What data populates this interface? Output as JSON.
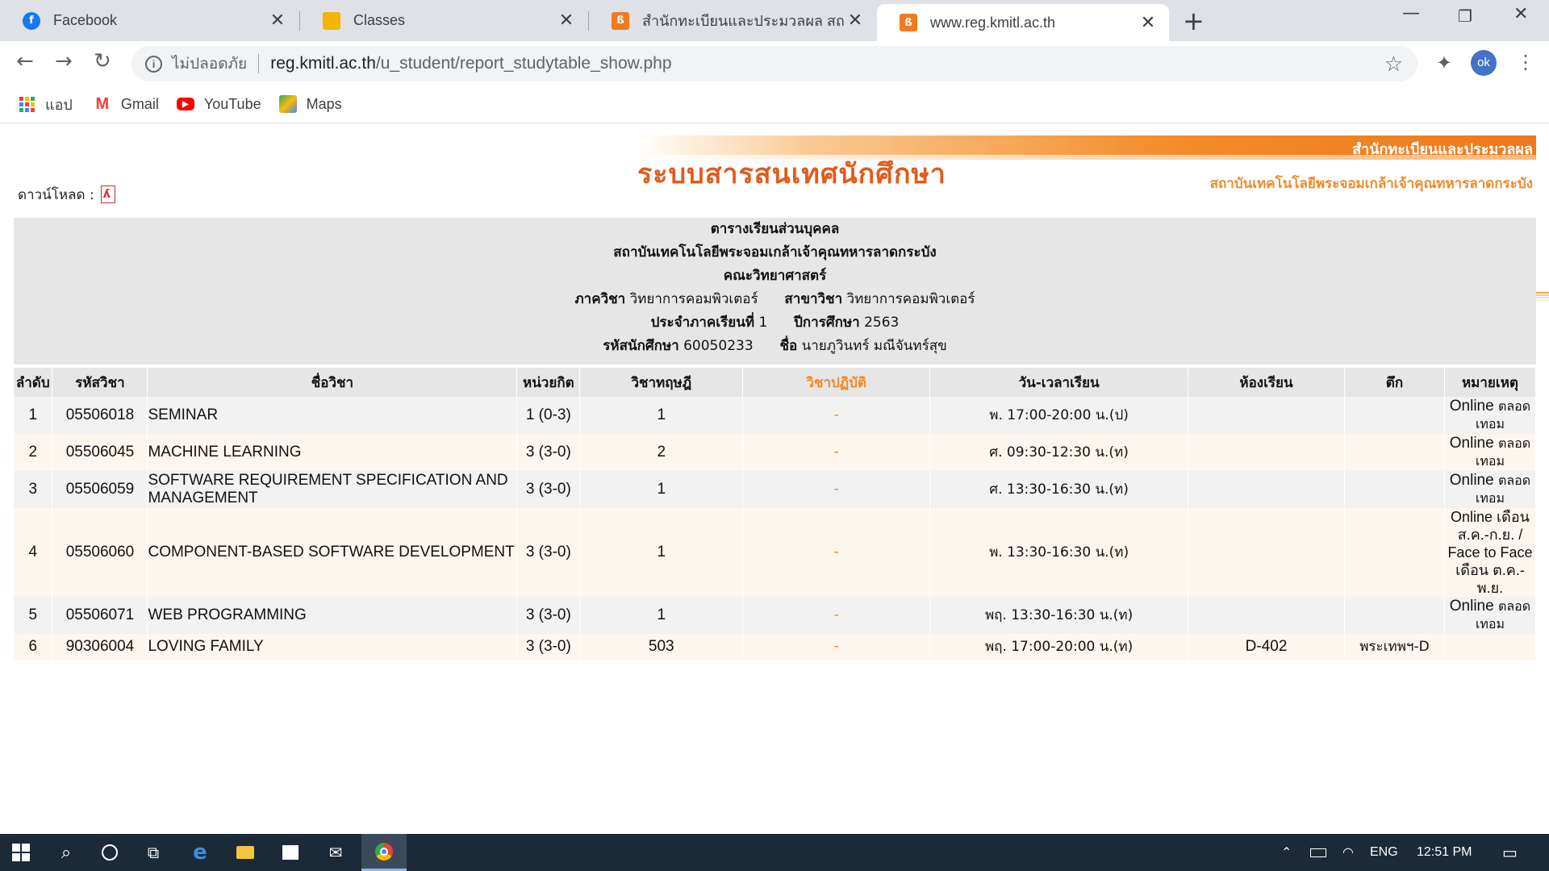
{
  "browser": {
    "tabs": [
      {
        "title": "Facebook",
        "favicon": "facebook-icon",
        "color": "#1877f2"
      },
      {
        "title": "Classes",
        "favicon": "classroom-icon",
        "color": "#f4b400"
      },
      {
        "title": "สำนักทะเบียนและประมวลผล สถาบันเท",
        "favicon": "reg-icon",
        "color": "#f07a20"
      },
      {
        "title": "www.reg.kmitl.ac.th",
        "favicon": "reg-icon",
        "color": "#f07a20"
      }
    ],
    "address": {
      "security_label": "ไม่ปลอดภัย",
      "host": "reg.kmitl.ac.th",
      "path": "/u_student/report_studytable_show.php"
    },
    "profile_initials": "ok",
    "bookmarks": [
      "แอป",
      "Gmail",
      "YouTube",
      "Maps"
    ]
  },
  "page": {
    "banner": {
      "system_title": "ระบบสารสนเทศนักศึกษา",
      "office": "สำนักทะเบียนและประมวลผล",
      "institute": "สถาบันเทคโนโลยีพระจอมเกล้าเจ้าคุณทหารลาดกระบัง"
    },
    "download_label": "ดาวน์โหลด :",
    "header": {
      "title": "ตารางเรียนส่วนบุคคล",
      "institute": "สถาบันเทคโนโลยีพระจอมเกล้าเจ้าคุณทหารลาดกระบัง",
      "faculty": "คณะวิทยาศาสตร์",
      "dept_label": "ภาควิชา",
      "dept_value": "วิทยาการคอมพิวเตอร์",
      "major_label": "สาขาวิชา",
      "major_value": "วิทยาการคอมพิวเตอร์",
      "semester_label": "ประจำภาคเรียนที่",
      "semester_value": "1",
      "year_label": "ปีการศึกษา",
      "year_value": "2563",
      "student_id_label": "รหัสนักศึกษา",
      "student_id_value": "60050233",
      "name_label": "ชื่อ",
      "name_value": "นายภูวินทร์ มณีจันทร์สุข"
    },
    "columns": [
      "ลำดับ",
      "รหัสวิชา",
      "ชื่อวิชา",
      "หน่วยกิต",
      "วิชาทฤษฎี",
      "วิชาปฏิบัติ",
      "วัน-เวลาเรียน",
      "ห้องเรียน",
      "ตึก",
      "หมายเหตุ"
    ],
    "rows": [
      {
        "no": "1",
        "code": "05506018",
        "name": "SEMINAR",
        "credit": "1 (0-3)",
        "theory": "1",
        "practice": "-",
        "time": "พ. 17:00-20:00 น.(ป)",
        "room": "",
        "building": "",
        "note_a": "Online",
        "note_b": "ตลอด",
        "note_c": "เทอม"
      },
      {
        "no": "2",
        "code": "05506045",
        "name": "MACHINE LEARNING",
        "credit": "3 (3-0)",
        "theory": "2",
        "practice": "-",
        "time": "ศ. 09:30-12:30 น.(ท)",
        "room": "",
        "building": "",
        "note_a": "Online",
        "note_b": "ตลอด",
        "note_c": "เทอม"
      },
      {
        "no": "3",
        "code": "05506059",
        "name": "SOFTWARE REQUIREMENT SPECIFICATION AND MANAGEMENT",
        "credit": "3 (3-0)",
        "theory": "1",
        "practice": "-",
        "time": "ศ. 13:30-16:30 น.(ท)",
        "room": "",
        "building": "",
        "note_a": "Online",
        "note_b": "ตลอด",
        "note_c": "เทอม"
      },
      {
        "no": "4",
        "code": "05506060",
        "name": "COMPONENT-BASED SOFTWARE DEVELOPMENT",
        "credit": "3 (3-0)",
        "theory": "1",
        "practice": "-",
        "time": "พ. 13:30-16:30 น.(ท)",
        "room": "",
        "building": "",
        "note_full": "Online เดือน ส.ค.-ก.ย. / Face to Face เดือน ต.ค.-พ.ย."
      },
      {
        "no": "5",
        "code": "05506071",
        "name": "WEB PROGRAMMING",
        "credit": "3 (3-0)",
        "theory": "1",
        "practice": "-",
        "time": "พฤ. 13:30-16:30 น.(ท)",
        "room": "",
        "building": "",
        "note_a": "Online",
        "note_b": "ตลอด",
        "note_c": "เทอม"
      },
      {
        "no": "6",
        "code": "90306004",
        "name": "LOVING FAMILY",
        "credit": "3 (3-0)",
        "theory": "503",
        "practice": "-",
        "time": "พฤ. 17:00-20:00 น.(ท)",
        "room": "D-402",
        "building": "พระเทพฯ-D",
        "note_a": "",
        "note_b": "",
        "note_c": ""
      }
    ]
  },
  "taskbar": {
    "language": "ENG",
    "clock": "12:51 PM"
  }
}
